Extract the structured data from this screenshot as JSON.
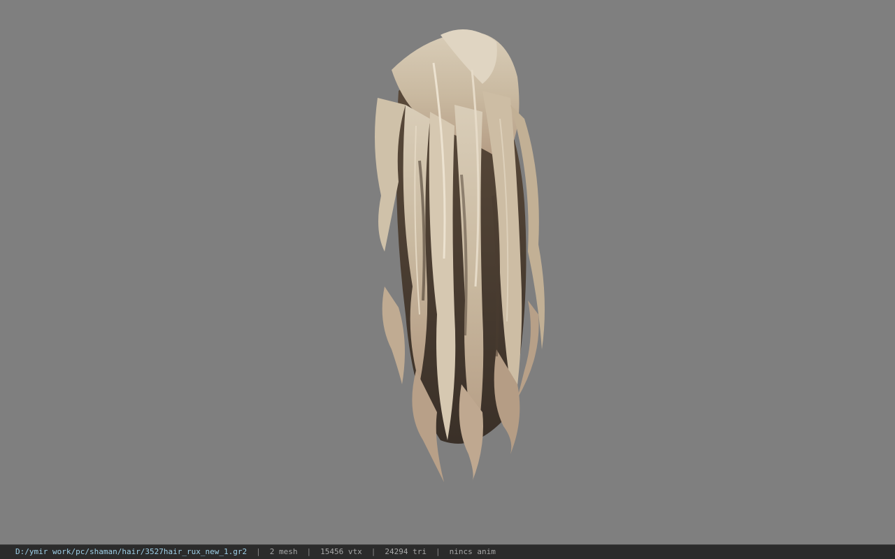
{
  "viewport": {
    "background": "#7f7f7f",
    "model": "long wavy hair mesh"
  },
  "statusbar": {
    "file_path": "D:/ymir work/pc/shaman/hair/3527hair_rux_new_1.gr2",
    "mesh_count": "2 mesh",
    "vertex_count": "15456 vtx",
    "triangle_count": "24294 tri",
    "anim": "nincs anim",
    "separator": "|"
  }
}
